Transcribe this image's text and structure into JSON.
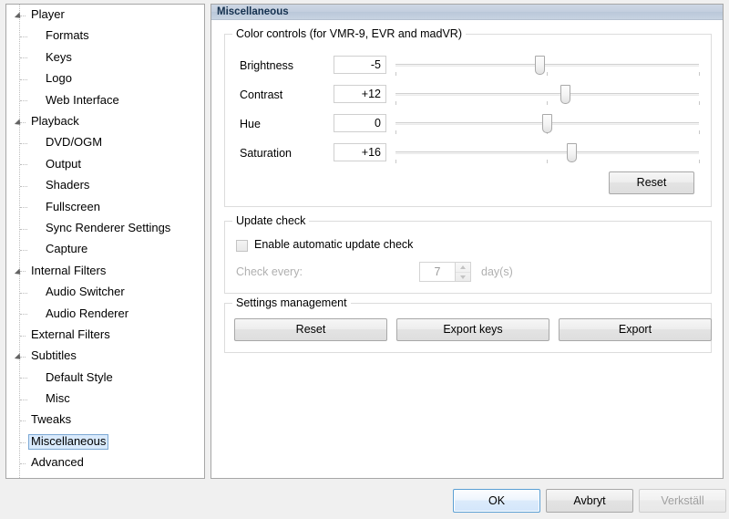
{
  "tree": {
    "items": [
      {
        "label": "Player",
        "level": 0,
        "arrow": "expanded",
        "selected": false
      },
      {
        "label": "Formats",
        "level": 1,
        "arrow": "none",
        "selected": false
      },
      {
        "label": "Keys",
        "level": 1,
        "arrow": "none",
        "selected": false
      },
      {
        "label": "Logo",
        "level": 1,
        "arrow": "none",
        "selected": false
      },
      {
        "label": "Web Interface",
        "level": 1,
        "arrow": "none",
        "selected": false
      },
      {
        "label": "Playback",
        "level": 0,
        "arrow": "expanded",
        "selected": false
      },
      {
        "label": "DVD/OGM",
        "level": 1,
        "arrow": "none",
        "selected": false
      },
      {
        "label": "Output",
        "level": 1,
        "arrow": "none",
        "selected": false
      },
      {
        "label": "Shaders",
        "level": 1,
        "arrow": "none",
        "selected": false
      },
      {
        "label": "Fullscreen",
        "level": 1,
        "arrow": "none",
        "selected": false
      },
      {
        "label": "Sync Renderer Settings",
        "level": 1,
        "arrow": "none",
        "selected": false
      },
      {
        "label": "Capture",
        "level": 1,
        "arrow": "none",
        "selected": false
      },
      {
        "label": "Internal Filters",
        "level": 0,
        "arrow": "expanded",
        "selected": false
      },
      {
        "label": "Audio Switcher",
        "level": 1,
        "arrow": "none",
        "selected": false
      },
      {
        "label": "Audio Renderer",
        "level": 1,
        "arrow": "none",
        "selected": false
      },
      {
        "label": "External Filters",
        "level": 0,
        "arrow": "none",
        "selected": false
      },
      {
        "label": "Subtitles",
        "level": 0,
        "arrow": "expanded",
        "selected": false
      },
      {
        "label": "Default Style",
        "level": 1,
        "arrow": "none",
        "selected": false
      },
      {
        "label": "Misc",
        "level": 1,
        "arrow": "none",
        "selected": false
      },
      {
        "label": "Tweaks",
        "level": 0,
        "arrow": "none",
        "selected": false
      },
      {
        "label": "Miscellaneous",
        "level": 0,
        "arrow": "none",
        "selected": true
      },
      {
        "label": "Advanced",
        "level": 0,
        "arrow": "none",
        "selected": false
      }
    ]
  },
  "panel": {
    "title": "Miscellaneous"
  },
  "color_controls": {
    "legend": "Color controls (for VMR-9, EVR and madVR)",
    "rows": [
      {
        "label": "Brightness",
        "value": "-5",
        "thumb_pct": 47.5
      },
      {
        "label": "Contrast",
        "value": "+12",
        "thumb_pct": 56.0
      },
      {
        "label": "Hue",
        "value": "0",
        "thumb_pct": 50.0
      },
      {
        "label": "Saturation",
        "value": "+16",
        "thumb_pct": 58.0
      }
    ],
    "reset_label": "Reset"
  },
  "update_check": {
    "legend": "Update check",
    "checkbox_label": "Enable automatic update check",
    "checkbox_checked": false,
    "check_every_label": "Check every:",
    "interval_value": "7",
    "days_label": "day(s)",
    "row_enabled": false
  },
  "settings_management": {
    "legend": "Settings management",
    "buttons": [
      {
        "label": "Reset"
      },
      {
        "label": "Export keys"
      },
      {
        "label": "Export"
      }
    ]
  },
  "dialog_buttons": {
    "ok": "OK",
    "cancel": "Avbryt",
    "apply": "Verkställ",
    "apply_enabled": false
  }
}
